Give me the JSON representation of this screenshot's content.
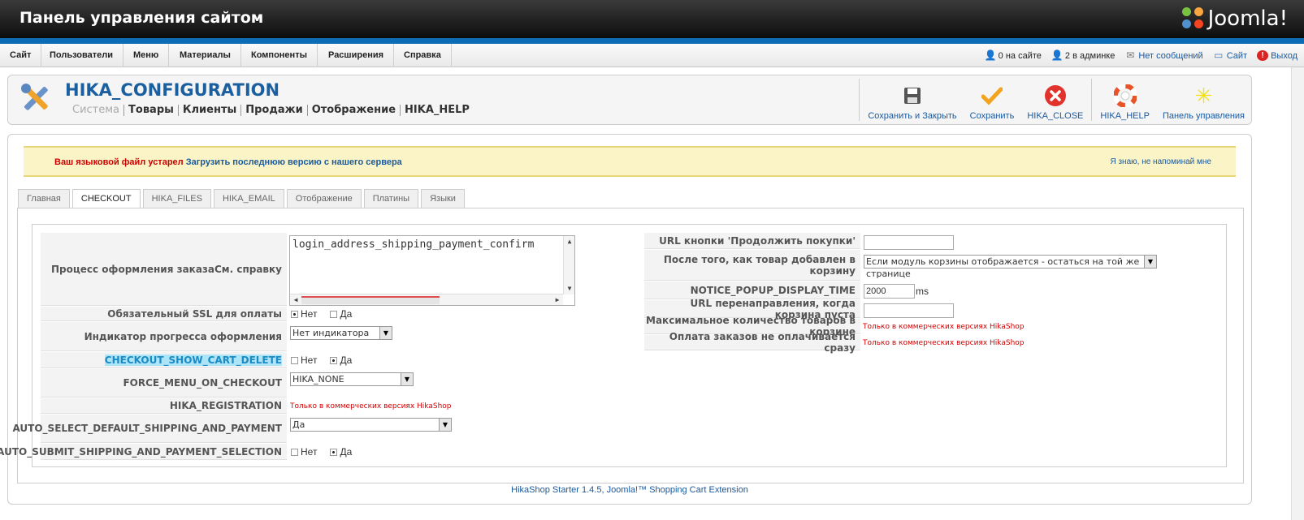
{
  "header": {
    "title": "Панель управления сайтом",
    "brand": "Joomla!"
  },
  "menu": {
    "items": [
      "Сайт",
      "Пользователи",
      "Меню",
      "Материалы",
      "Компоненты",
      "Расширения",
      "Справка"
    ]
  },
  "status": {
    "online": "0 на сайте",
    "admins": "2 в админке",
    "messages": "Нет сообщений",
    "site": "Сайт",
    "logout": "Выход"
  },
  "page": {
    "title": "HIKA_CONFIGURATION",
    "subnav": [
      "Система",
      "Товары",
      "Клиенты",
      "Продажи",
      "Отображение",
      "HIKA_HELP"
    ]
  },
  "toolbar": {
    "save_close": "Сохранить и Закрыть",
    "save": "Сохранить",
    "close": "HIKA_CLOSE",
    "help": "HIKA_HELP",
    "dashboard": "Панель управления"
  },
  "notice": {
    "warning": "Ваш языковой файл устарел",
    "download": "Загрузить последнюю версию с нашего сервера",
    "dismiss": "Я знаю, не напоминай мне"
  },
  "tabs": [
    "Главная",
    "CHECKOUT",
    "HIKA_FILES",
    "HIKA_EMAIL",
    "Отображение",
    "Платины",
    "Языки"
  ],
  "left": {
    "checkout_process_label": "Процесс оформления заказаСм. справку",
    "checkout_process_value": "login_address_shipping_payment_confirm",
    "ssl_label": "Обязательный SSL для оплаты",
    "progress_label": "Индикатор прогресса оформления",
    "progress_value": "Нет индикатора",
    "cart_delete_label": "CHECKOUT_SHOW_CART_DELETE",
    "force_menu_label": "FORCE_MENU_ON_CHECKOUT",
    "force_menu_value": "HIKA_NONE",
    "registration_label": "HIKA_REGISTRATION",
    "auto_select_label": "AUTO_SELECT_DEFAULT_SHIPPING_AND_PAYMENT",
    "auto_select_value": "Да",
    "auto_submit_label": "AUTO_SUBMIT_SHIPPING_AND_PAYMENT_SELECTION"
  },
  "right": {
    "continue_url_label": "URL кнопки 'Продолжить покупки'",
    "after_add_label": "После того, как товар добавлен в корзину",
    "after_add_value": "Если модуль корзины отображается - остаться на той же странице",
    "popup_time_label": "NOTICE_POPUP_DISPLAY_TIME",
    "popup_time_value": "2000",
    "popup_time_unit": "ms",
    "redirect_label": "URL перенаправления, когда корзина пуста",
    "max_items_label": "Максимальное количество товаров в корзине",
    "deferred_payment_label": "Оплата заказов не оплачивается сразу"
  },
  "radio": {
    "no": "Нет",
    "yes": "Да"
  },
  "commercial_only": "Только в коммерческих версиях HikaShop",
  "footer": "HikaShop Starter 1.4.5, Joomla!™ Shopping Cart Extension"
}
